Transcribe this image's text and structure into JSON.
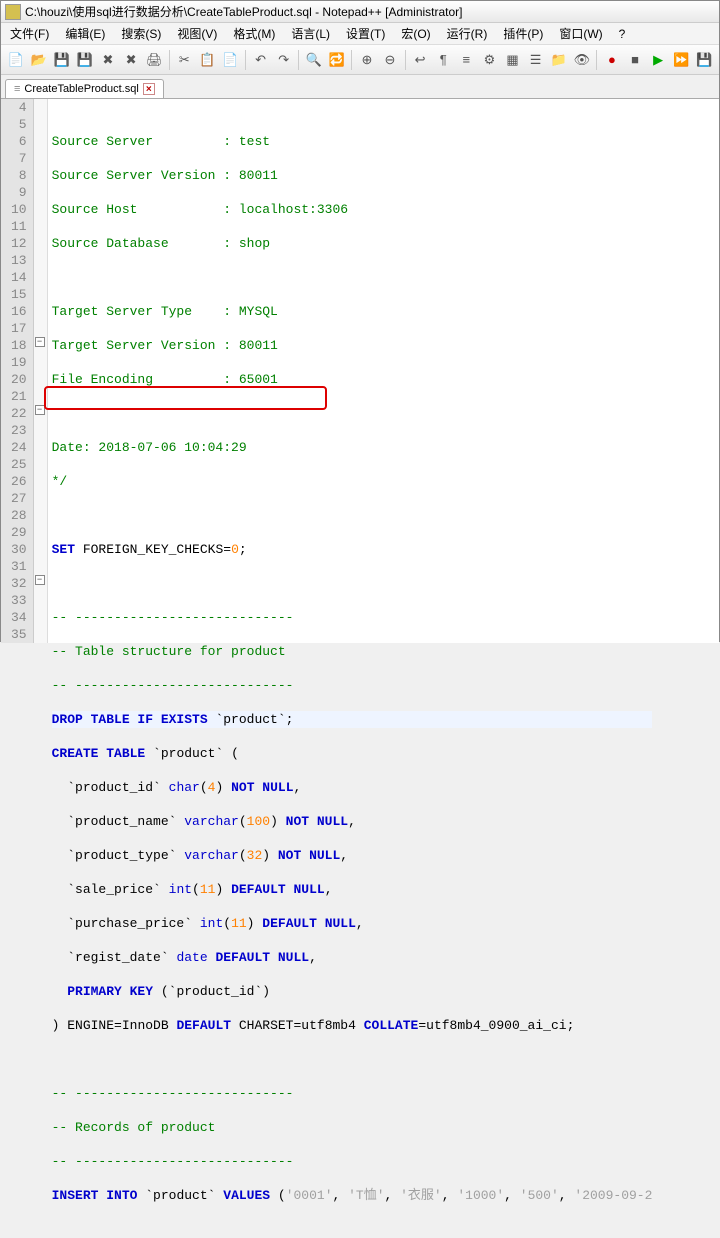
{
  "window": {
    "title": "C:\\houzi\\使用sql进行数据分析\\CreateTableProduct.sql - Notepad++ [Administrator]"
  },
  "menu": {
    "file": "文件(F)",
    "edit": "编辑(E)",
    "search": "搜索(S)",
    "view": "视图(V)",
    "format": "格式(M)",
    "language": "语言(L)",
    "settings": "设置(T)",
    "macro": "宏(O)",
    "run": "运行(R)",
    "plugins": "插件(P)",
    "window": "窗口(W)",
    "help": "?"
  },
  "tab": {
    "label": "CreateTableProduct.sql"
  },
  "gutter": {
    "start": 4,
    "end": 35
  },
  "code": {
    "l4": {
      "a": "Source Server         : test"
    },
    "l5": {
      "a": "Source Server Version : 80011"
    },
    "l6": {
      "a": "Source Host           : localhost:3306"
    },
    "l7": {
      "a": "Source Database       : shop"
    },
    "l8": {
      "a": ""
    },
    "l9": {
      "a": "Target Server Type    : MYSQL"
    },
    "l10": {
      "a": "Target Server Version : 80011"
    },
    "l11": {
      "a": "File Encoding         : 65001"
    },
    "l12": {
      "a": ""
    },
    "l13": {
      "a": "Date: 2018-07-06 10:04:29"
    },
    "l14": {
      "a": "*/"
    },
    "l15": {
      "a": ""
    },
    "l16": {
      "a": "SET",
      "b": " FOREIGN_KEY_CHECKS",
      "c": "=",
      "d": "0",
      "e": ";"
    },
    "l17": {
      "a": ""
    },
    "l18": {
      "a": "-- ----------------------------"
    },
    "l19": {
      "a": "-- Table structure for product"
    },
    "l20": {
      "a": "-- ----------------------------"
    },
    "l21": {
      "a": "DROP TABLE IF EXISTS",
      "b": " `product`",
      "c": ";"
    },
    "l22": {
      "a": "CREATE TABLE",
      "b": " `product` ",
      "c": "("
    },
    "l23": {
      "a": "  `product_id` ",
      "b": "char",
      "c": "(",
      "d": "4",
      "e": ")",
      "f": " NOT NULL",
      "g": ","
    },
    "l24": {
      "a": "  `product_name` ",
      "b": "varchar",
      "c": "(",
      "d": "100",
      "e": ")",
      "f": " NOT NULL",
      "g": ","
    },
    "l25": {
      "a": "  `product_type` ",
      "b": "varchar",
      "c": "(",
      "d": "32",
      "e": ")",
      "f": " NOT NULL",
      "g": ","
    },
    "l26": {
      "a": "  `sale_price` ",
      "b": "int",
      "c": "(",
      "d": "11",
      "e": ")",
      "f": " DEFAULT NULL",
      "g": ","
    },
    "l27": {
      "a": "  `purchase_price` ",
      "b": "int",
      "c": "(",
      "d": "11",
      "e": ")",
      "f": " DEFAULT NULL",
      "g": ","
    },
    "l28": {
      "a": "  `regist_date` ",
      "b": "date",
      "f": " DEFAULT NULL",
      "g": ","
    },
    "l29": {
      "a": "  PRIMARY KEY ",
      "b": "(",
      "c": "`product_id`",
      "d": ")"
    },
    "l30": {
      "a": ")",
      "b": " ENGINE",
      "c": "=",
      "d": "InnoDB ",
      "e": "DEFAULT",
      "f": " CHARSET",
      "g": "=",
      "h": "utf8mb4 ",
      "i": "COLLATE",
      "j": "=",
      "k": "utf8mb4_0900_ai_ci",
      "l": ";"
    },
    "l31": {
      "a": ""
    },
    "l32": {
      "a": "-- ----------------------------"
    },
    "l33": {
      "a": "-- Records of product"
    },
    "l34": {
      "a": "-- ----------------------------"
    },
    "l35": {
      "a": "INSERT INTO",
      "b": " `product` ",
      "c": "VALUES ",
      "d": "(",
      "e": "'0001'",
      "f": ", ",
      "g": "'T恤'",
      "h": ", ",
      "i": "'衣服'",
      "j": ", ",
      "k": "'1000'",
      "l": ", ",
      "m": "'500'",
      "n": ", ",
      "o": "'2009-09-2"
    }
  }
}
